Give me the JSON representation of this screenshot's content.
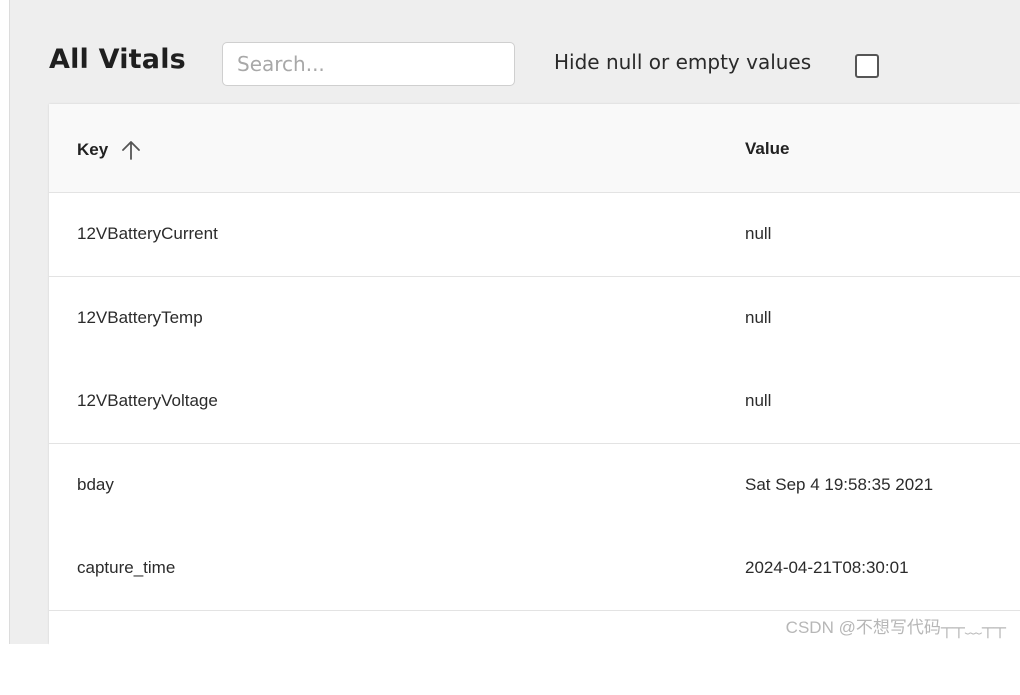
{
  "header": {
    "title": "All Vitals",
    "search_placeholder": "Search...",
    "search_value": "",
    "hide_null_label": "Hide null or empty values",
    "hide_null_checked": false
  },
  "table": {
    "columns": {
      "key": "Key",
      "value": "Value",
      "sort": "ascending",
      "sort_icon": "arrow-up-icon"
    },
    "rows": [
      {
        "key": "12VBatteryCurrent",
        "value": "null"
      },
      {
        "key": "12VBatteryTemp",
        "value": "null"
      },
      {
        "key": "12VBatteryVoltage",
        "value": "null"
      },
      {
        "key": "bday",
        "value": "Sat Sep 4 19:58:35 2021"
      },
      {
        "key": "capture_time",
        "value": "2024-04-21T08:30:01"
      },
      {
        "key": "",
        "value": ""
      }
    ]
  },
  "watermark": "CSDN @不想写代码┬┬﹏┬┬",
  "colors": {
    "panel_bg": "#eeeeee",
    "header_bg": "#f9f9f9",
    "row_border": "#e3e3e3",
    "text": "#2b2b2b"
  }
}
